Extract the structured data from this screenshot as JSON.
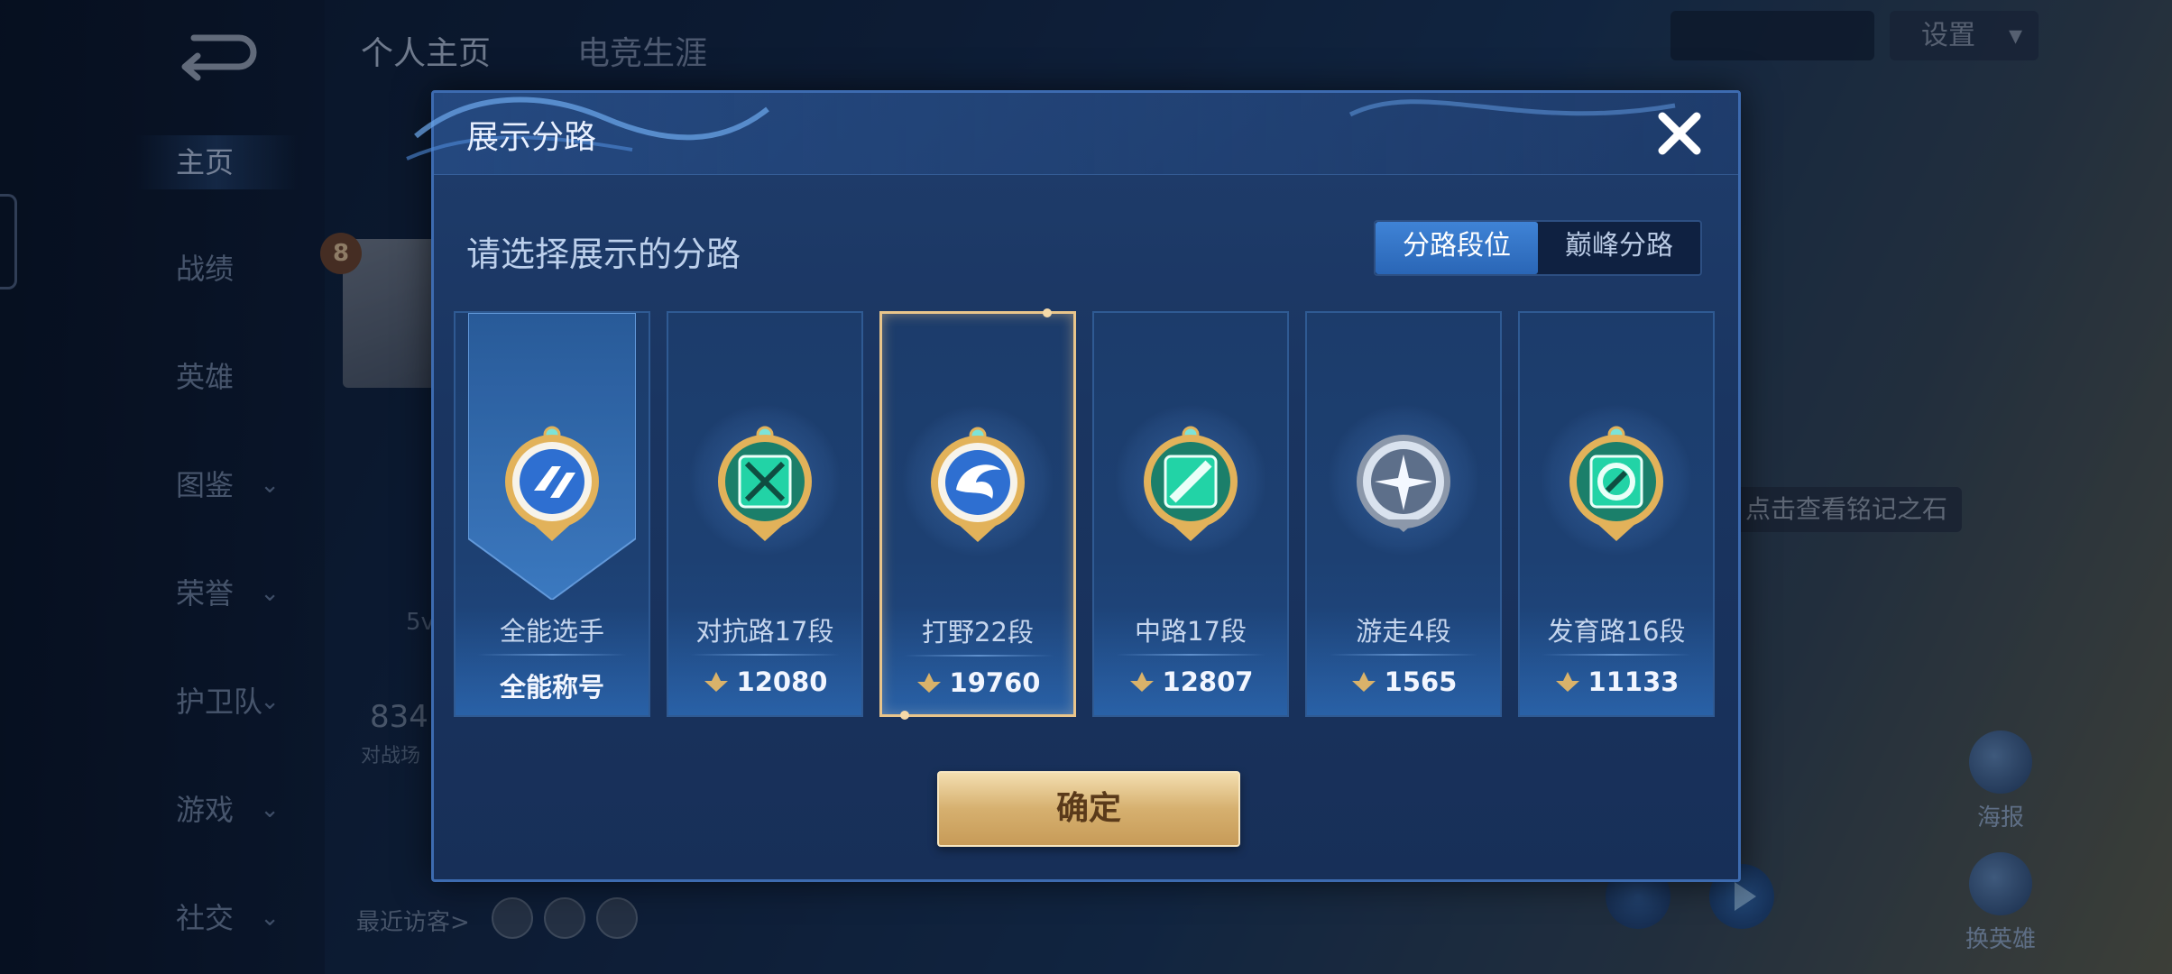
{
  "background": {
    "top_tabs": [
      "个人主页",
      "电竞生涯"
    ],
    "settings_label": "设置",
    "sidebar_items": [
      {
        "label": "主页",
        "active": true,
        "has_chevron": false
      },
      {
        "label": "战绩",
        "active": false,
        "has_chevron": false
      },
      {
        "label": "英雄",
        "active": false,
        "has_chevron": false
      },
      {
        "label": "图鉴",
        "active": false,
        "has_chevron": true
      },
      {
        "label": "荣誉",
        "active": false,
        "has_chevron": true
      },
      {
        "label": "护卫队",
        "active": false,
        "has_chevron": true
      },
      {
        "label": "游戏",
        "active": false,
        "has_chevron": true
      },
      {
        "label": "社交",
        "active": false,
        "has_chevron": true
      }
    ],
    "player_level": "8",
    "stat_partial": "834",
    "stat_partial_label": "对战场",
    "mode_partial": "5v",
    "recent_visitors_label": "最近访客>",
    "hint_text": "点击查看铭记之石",
    "right_icons": [
      "海报",
      "换英雄"
    ]
  },
  "dialog": {
    "title": "展示分路",
    "subtitle": "请选择展示的分路",
    "toggle": {
      "options": [
        "分路段位",
        "巅峰分路"
      ],
      "selected_index": 0
    },
    "cards": [
      {
        "name": "全能选手",
        "value": "全能称号",
        "emblem": "all-round-emblem-icon",
        "selected": false,
        "show_score_icon": false
      },
      {
        "name": "对抗路17段",
        "value": "12080",
        "emblem": "clash-lane-emblem-icon",
        "selected": false,
        "show_score_icon": true
      },
      {
        "name": "打野22段",
        "value": "19760",
        "emblem": "jungle-emblem-icon",
        "selected": true,
        "show_score_icon": true
      },
      {
        "name": "中路17段",
        "value": "12807",
        "emblem": "mid-lane-emblem-icon",
        "selected": false,
        "show_score_icon": true
      },
      {
        "name": "游走4段",
        "value": "1565",
        "emblem": "roam-emblem-icon",
        "selected": false,
        "show_score_icon": true
      },
      {
        "name": "发育路16段",
        "value": "11133",
        "emblem": "farm-lane-emblem-icon",
        "selected": false,
        "show_score_icon": true
      }
    ],
    "confirm_label": "确定"
  },
  "colors": {
    "accent_blue": "#2a66b6",
    "selected_border": "#e9c58b",
    "emblem_gold": "#e2b25a",
    "emblem_teal": "#1fc9a0",
    "emblem_blue": "#2e6fd1"
  }
}
